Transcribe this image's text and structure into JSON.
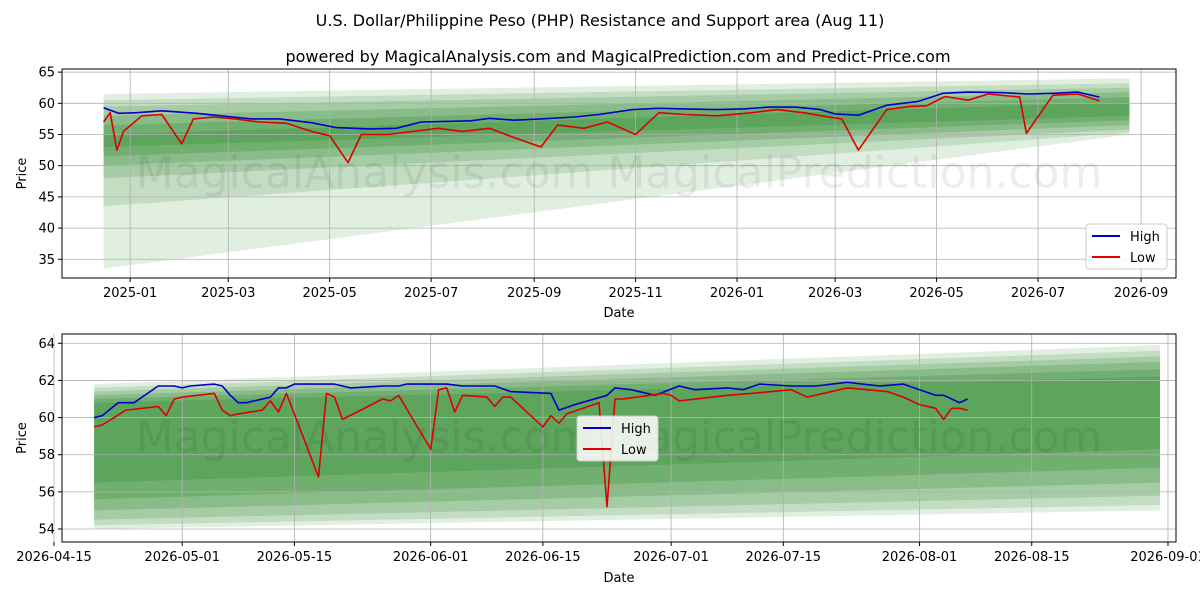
{
  "titles": {
    "title": "U.S. Dollar/Philippine Peso (PHP) Resistance and Support area (Aug 11)",
    "subtitle": "powered by MagicalAnalysis.com and MagicalPrediction.com and Predict-Price.com"
  },
  "watermark": "MagicalAnalysis.com   MagicalPrediction.com",
  "colors": {
    "high": "#0000cc",
    "low": "#dd0000",
    "band": "#2e8b2e",
    "grid": "#b0b0b0"
  },
  "chart_data": [
    {
      "type": "line",
      "xlabel": "Date",
      "ylabel": "Price",
      "ylim": [
        32,
        65.5
      ],
      "xlim": [
        "2024-11-21",
        "2026-09-22"
      ],
      "yticks": [
        35,
        40,
        45,
        50,
        55,
        60,
        65
      ],
      "xticks": [
        "2025-01",
        "2025-03",
        "2025-05",
        "2025-07",
        "2025-09",
        "2025-11",
        "2026-01",
        "2026-03",
        "2026-05",
        "2026-07",
        "2026-09"
      ],
      "grid": true,
      "legend_position": "lower right",
      "bands": {
        "x_start": "2024-12-16",
        "x_end": "2026-08-25",
        "upper_start": [
          61.5,
          60.5,
          59.5,
          58,
          56.5,
          55
        ],
        "upper_end": [
          64,
          63.2,
          62.5,
          61.8,
          61,
          60.2
        ],
        "lower_start": [
          33.5,
          43.5,
          48,
          50,
          51.5,
          53
        ],
        "lower_end": [
          55,
          55.3,
          55.8,
          56.5,
          57.3,
          58
        ]
      },
      "series": [
        {
          "name": "High",
          "x": [
            "2024-12-16",
            "2024-12-25",
            "2025-01-05",
            "2025-01-20",
            "2025-02-10",
            "2025-02-28",
            "2025-03-15",
            "2025-04-01",
            "2025-04-20",
            "2025-05-05",
            "2025-05-25",
            "2025-06-10",
            "2025-06-25",
            "2025-07-10",
            "2025-07-25",
            "2025-08-05",
            "2025-08-20",
            "2025-09-05",
            "2025-09-25",
            "2025-10-10",
            "2025-10-30",
            "2025-11-15",
            "2025-12-01",
            "2025-12-20",
            "2026-01-05",
            "2026-01-20",
            "2026-02-05",
            "2026-02-20",
            "2026-03-01",
            "2026-03-15",
            "2026-04-01",
            "2026-04-20",
            "2026-05-05",
            "2026-05-20",
            "2026-06-10",
            "2026-06-25",
            "2026-07-10",
            "2026-07-25",
            "2026-08-07"
          ],
          "values": [
            59.3,
            58.4,
            58.5,
            58.8,
            58.4,
            57.9,
            57.5,
            57.5,
            56.9,
            56.1,
            55.9,
            56.0,
            57.0,
            57.1,
            57.2,
            57.6,
            57.3,
            57.5,
            57.8,
            58.2,
            59.0,
            59.2,
            59.1,
            59.0,
            59.1,
            59.4,
            59.4,
            59.0,
            58.3,
            58.1,
            59.7,
            60.3,
            61.6,
            61.8,
            61.7,
            61.5,
            61.6,
            61.8,
            61.0
          ]
        },
        {
          "name": "Low",
          "x": [
            "2024-12-16",
            "2024-12-20",
            "2024-12-24",
            "2024-12-28",
            "2025-01-08",
            "2025-01-20",
            "2025-02-01",
            "2025-02-08",
            "2025-02-20",
            "2025-03-05",
            "2025-03-20",
            "2025-04-05",
            "2025-04-20",
            "2025-05-01",
            "2025-05-12",
            "2025-05-20",
            "2025-06-05",
            "2025-06-20",
            "2025-07-05",
            "2025-07-20",
            "2025-08-05",
            "2025-08-20",
            "2025-09-05",
            "2025-09-15",
            "2025-10-01",
            "2025-10-15",
            "2025-11-01",
            "2025-11-15",
            "2025-12-01",
            "2025-12-20",
            "2026-01-10",
            "2026-01-25",
            "2026-02-10",
            "2026-02-25",
            "2026-03-05",
            "2026-03-15",
            "2026-04-01",
            "2026-04-15",
            "2026-04-25",
            "2026-05-06",
            "2026-05-20",
            "2026-06-01",
            "2026-06-20",
            "2026-06-24",
            "2026-07-10",
            "2026-07-25",
            "2026-08-07"
          ],
          "values": [
            57.0,
            58.5,
            52.5,
            55.5,
            58.0,
            58.2,
            53.5,
            57.5,
            57.8,
            57.5,
            57.0,
            56.8,
            55.5,
            54.8,
            50.5,
            55.0,
            55.0,
            55.5,
            56.0,
            55.5,
            56.0,
            54.5,
            53.0,
            56.5,
            56.0,
            57.0,
            55.0,
            58.5,
            58.2,
            58.0,
            58.5,
            59.0,
            58.5,
            57.8,
            57.5,
            52.5,
            59.0,
            59.5,
            59.6,
            61.1,
            60.5,
            61.5,
            61.0,
            55.2,
            61.3,
            61.5,
            60.4
          ]
        }
      ]
    },
    {
      "type": "line",
      "xlabel": "Date",
      "ylabel": "Price",
      "ylim": [
        53.3,
        64.5
      ],
      "xlim": [
        "2026-04-16",
        "2026-09-02"
      ],
      "yticks": [
        54,
        56,
        58,
        60,
        62,
        64
      ],
      "xticks": [
        "2026-04-15",
        "2026-05-01",
        "2026-05-15",
        "2026-06-01",
        "2026-06-15",
        "2026-07-01",
        "2026-07-15",
        "2026-08-01",
        "2026-08-15",
        "2026-09-01"
      ],
      "grid": true,
      "legend_position": "center",
      "bands": {
        "x_start": "2026-04-20",
        "x_end": "2026-08-31",
        "upper_start": [
          61.8,
          61.6,
          61.4,
          61.2,
          61.0,
          60.8
        ],
        "upper_end": [
          63.9,
          63.6,
          63.3,
          63.0,
          62.6,
          62.2
        ],
        "lower_start": [
          54.0,
          54.2,
          54.5,
          55.0,
          55.6,
          56.5
        ],
        "lower_end": [
          55.0,
          55.3,
          55.8,
          56.5,
          57.3,
          58.3
        ]
      },
      "series": [
        {
          "name": "High",
          "x": [
            "2026-04-20",
            "2026-04-21",
            "2026-04-23",
            "2026-04-25",
            "2026-04-28",
            "2026-04-29",
            "2026-04-30",
            "2026-05-01",
            "2026-05-02",
            "2026-05-05",
            "2026-05-06",
            "2026-05-07",
            "2026-05-08",
            "2026-05-09",
            "2026-05-12",
            "2026-05-13",
            "2026-05-14",
            "2026-05-15",
            "2026-05-20",
            "2026-05-22",
            "2026-05-26",
            "2026-05-28",
            "2026-05-29",
            "2026-06-01",
            "2026-06-03",
            "2026-06-05",
            "2026-06-09",
            "2026-06-11",
            "2026-06-16",
            "2026-06-17",
            "2026-06-19",
            "2026-06-23",
            "2026-06-24",
            "2026-06-26",
            "2026-06-29",
            "2026-07-02",
            "2026-07-04",
            "2026-07-08",
            "2026-07-10",
            "2026-07-12",
            "2026-07-16",
            "2026-07-19",
            "2026-07-23",
            "2026-07-27",
            "2026-07-30",
            "2026-08-01",
            "2026-08-03",
            "2026-08-04",
            "2026-08-05",
            "2026-08-06",
            "2026-08-07"
          ],
          "values": [
            60.0,
            60.1,
            60.8,
            60.8,
            61.7,
            61.7,
            61.7,
            61.6,
            61.7,
            61.8,
            61.7,
            61.2,
            60.8,
            60.8,
            61.1,
            61.6,
            61.6,
            61.8,
            61.8,
            61.6,
            61.7,
            61.7,
            61.8,
            61.8,
            61.8,
            61.7,
            61.7,
            61.4,
            61.3,
            60.4,
            60.7,
            61.2,
            61.6,
            61.5,
            61.2,
            61.7,
            61.5,
            61.6,
            61.5,
            61.8,
            61.7,
            61.7,
            61.9,
            61.7,
            61.8,
            61.5,
            61.2,
            61.2,
            61.0,
            60.8,
            61.0
          ]
        },
        {
          "name": "Low",
          "x": [
            "2026-04-20",
            "2026-04-21",
            "2026-04-24",
            "2026-04-28",
            "2026-04-29",
            "2026-04-30",
            "2026-05-01",
            "2026-05-05",
            "2026-05-06",
            "2026-05-07",
            "2026-05-08",
            "2026-05-11",
            "2026-05-12",
            "2026-05-13",
            "2026-05-14",
            "2026-05-18",
            "2026-05-19",
            "2026-05-20",
            "2026-05-21",
            "2026-05-26",
            "2026-05-27",
            "2026-05-28",
            "2026-06-01",
            "2026-06-02",
            "2026-06-03",
            "2026-06-04",
            "2026-06-05",
            "2026-06-08",
            "2026-06-09",
            "2026-06-10",
            "2026-06-11",
            "2026-06-15",
            "2026-06-16",
            "2026-06-17",
            "2026-06-18",
            "2026-06-22",
            "2026-06-23",
            "2026-06-24",
            "2026-06-25",
            "2026-06-30",
            "2026-07-01",
            "2026-07-02",
            "2026-07-08",
            "2026-07-11",
            "2026-07-16",
            "2026-07-18",
            "2026-07-22",
            "2026-07-23",
            "2026-07-28",
            "2026-07-30",
            "2026-08-01",
            "2026-08-03",
            "2026-08-04",
            "2026-08-05",
            "2026-08-06",
            "2026-08-07"
          ],
          "values": [
            59.5,
            59.6,
            60.4,
            60.6,
            60.1,
            61.0,
            61.1,
            61.3,
            60.4,
            60.1,
            60.2,
            60.4,
            60.9,
            60.3,
            61.3,
            56.8,
            61.3,
            61.1,
            59.9,
            61.0,
            60.9,
            61.2,
            58.3,
            61.5,
            61.6,
            60.3,
            61.2,
            61.1,
            60.6,
            61.1,
            61.1,
            59.5,
            60.1,
            59.7,
            60.2,
            60.8,
            55.2,
            61.0,
            61.0,
            61.3,
            61.2,
            60.9,
            61.2,
            61.3,
            61.5,
            61.1,
            61.5,
            61.6,
            61.4,
            61.1,
            60.7,
            60.5,
            59.9,
            60.5,
            60.5,
            60.4
          ]
        }
      ]
    }
  ]
}
